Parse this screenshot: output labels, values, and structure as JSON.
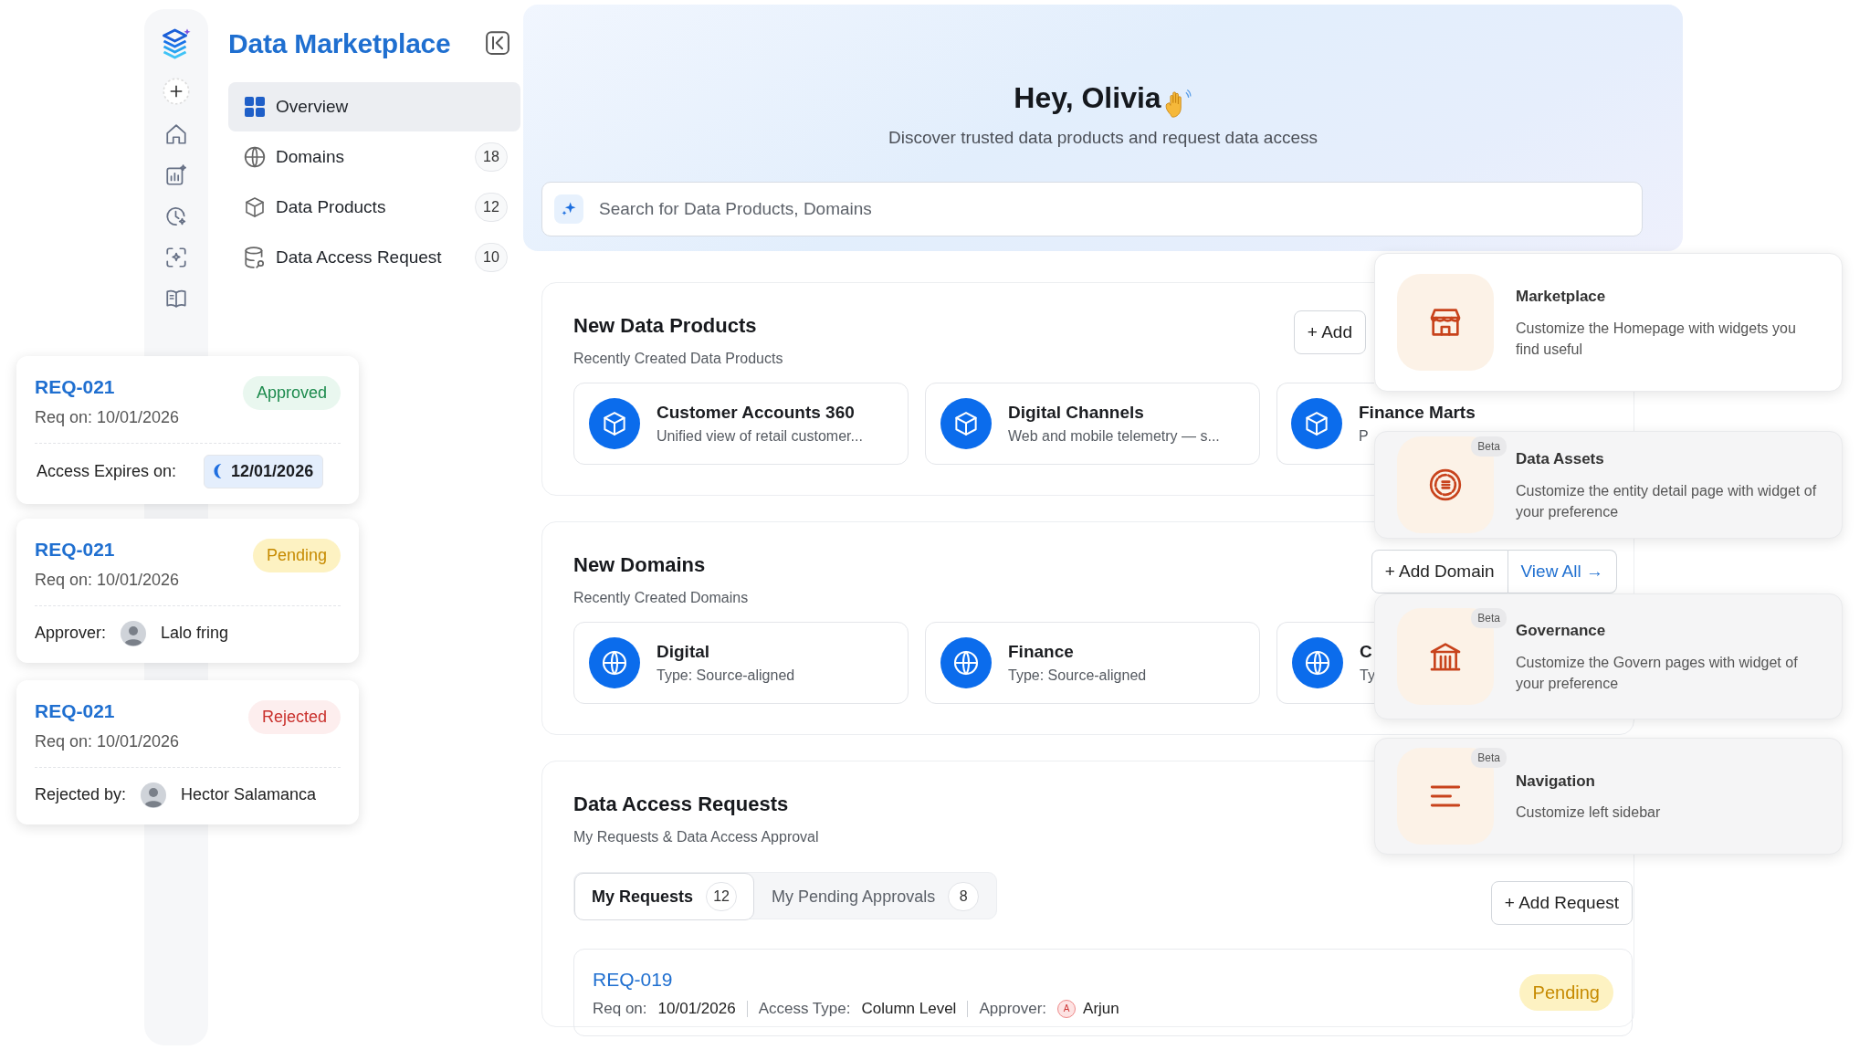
{
  "sidebar": {
    "title": "Data Marketplace",
    "items": [
      {
        "label": "Overview",
        "kind": "overview",
        "selected": true
      },
      {
        "label": "Domains",
        "kind": "domains",
        "count": "18",
        "selected": false
      },
      {
        "label": "Data Products",
        "kind": "products",
        "count": "12",
        "selected": false
      },
      {
        "label": "Data Access Request",
        "kind": "requests",
        "count": "10",
        "selected": false
      }
    ]
  },
  "hero": {
    "greeting": "Hey, Olivia",
    "subtitle": "Discover trusted data products and request data access"
  },
  "search": {
    "placeholder": "Search for Data Products, Domains"
  },
  "new_data_products": {
    "title": "New Data Products",
    "subtitle": "Recently Created Data Products",
    "actions": [
      "+ Add"
    ],
    "cards": [
      {
        "title": "Customer Accounts 360",
        "subtitle": "Unified view of retail customer..."
      },
      {
        "title": "Digital Channels",
        "subtitle": "Web and mobile telemetry — s..."
      },
      {
        "title": "Finance Marts",
        "subtitle": "P"
      }
    ]
  },
  "new_domains": {
    "title": "New Domains",
    "subtitle": "Recently Created Domains",
    "actions": [
      "+ Add Domain",
      "View All →"
    ],
    "cards": [
      {
        "title": "Digital",
        "subtitle": "Type: Source-aligned"
      },
      {
        "title": "Finance",
        "subtitle": "Type: Source-aligned"
      },
      {
        "title": "C",
        "subtitle": "Ty"
      }
    ]
  },
  "data_access_requests": {
    "title": "Data Access Requests",
    "subtitle": "My Requests & Data Access Approval",
    "tabs": [
      {
        "label": "My Requests",
        "count": "12",
        "selected": true
      },
      {
        "label": "My Pending Approvals",
        "count": "8",
        "selected": false
      }
    ],
    "actions": [
      "+ Add Request"
    ],
    "requests": [
      {
        "id": "REQ-019",
        "req_on_label": "Req on:",
        "req_on": "10/01/2026",
        "access_type_label": "Access Type:",
        "access_type": "Column Level",
        "approver_label": "Approver:",
        "approver_initial": "A",
        "approver": "Arjun",
        "status": "Pending",
        "kind": "pending"
      }
    ]
  },
  "request_cards": [
    {
      "id": "REQ-021",
      "status": "Approved",
      "kind": "approved",
      "req_on_label": "Req on:",
      "req_on": "10/01/2026",
      "detail": {
        "kind": "expiry",
        "label": "Access Expires on:",
        "value": "12/01/2026"
      }
    },
    {
      "id": "REQ-021",
      "status": "Pending",
      "kind": "pending",
      "req_on_label": "Req on:",
      "req_on": "10/01/2026",
      "detail": {
        "kind": "person",
        "label": "Approver:",
        "value": "Lalo fring"
      }
    },
    {
      "id": "REQ-021",
      "status": "Rejected",
      "kind": "rejected",
      "req_on_label": "Req on:",
      "req_on": "10/01/2026",
      "detail": {
        "kind": "person",
        "label": "Rejected by:",
        "value": "Hector Salamanca"
      }
    }
  ],
  "widgets": [
    {
      "title": "Marketplace",
      "description": "Customize the Homepage with widgets you find useful",
      "kind": "store",
      "beta": false
    },
    {
      "title": "Data Assets",
      "description": "Customize the entity detail page with widget of your preference",
      "kind": "target",
      "beta": true,
      "beta_label": "Beta"
    },
    {
      "title": "Governance",
      "description": "Customize the Govern pages with widget of your preference",
      "kind": "bank",
      "beta": true,
      "beta_label": "Beta"
    },
    {
      "title": "Navigation",
      "description": "Customize left sidebar",
      "kind": "menu",
      "beta": true,
      "beta_label": "Beta"
    }
  ]
}
